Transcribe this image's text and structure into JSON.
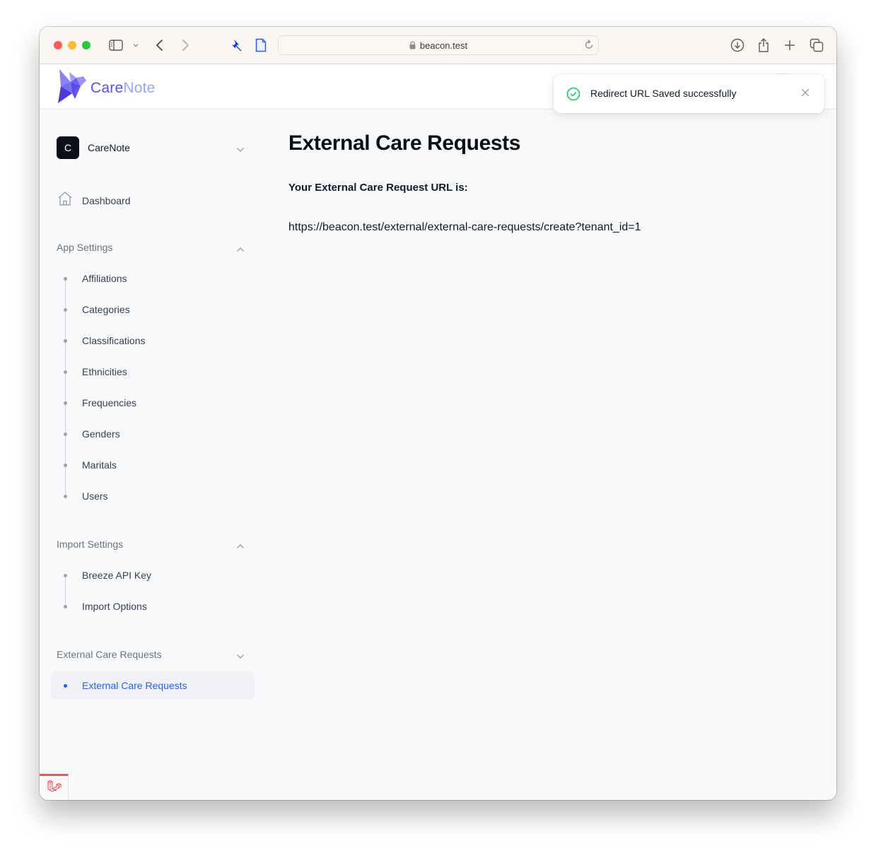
{
  "browser": {
    "url": "beacon.test",
    "icons": [
      "sidebar-icon",
      "chevron-down-icon",
      "back-icon",
      "forward-icon",
      "pin-icon",
      "page-icon",
      "lock-icon",
      "reload-icon",
      "download-icon",
      "share-icon",
      "new-tab-icon",
      "tab-overview-icon"
    ]
  },
  "header": {
    "brand_part1": "Care",
    "brand_part2": "Note"
  },
  "sidebar": {
    "tenant": {
      "initial": "C",
      "name": "CareNote"
    },
    "dashboard_label": "Dashboard",
    "groups": [
      {
        "title": "App Settings",
        "expanded": true,
        "items": [
          "Affiliations",
          "Categories",
          "Classifications",
          "Ethnicities",
          "Frequencies",
          "Genders",
          "Maritals",
          "Users"
        ]
      },
      {
        "title": "Import Settings",
        "expanded": true,
        "items": [
          "Breeze API Key",
          "Import Options"
        ]
      },
      {
        "title": "External Care Requests",
        "expanded": true,
        "items": [
          "External Care Requests"
        ],
        "active_item": "External Care Requests"
      }
    ]
  },
  "main": {
    "title": "External Care Requests",
    "url_label": "Your External Care Request URL is:",
    "url_value": "https://beacon.test/external/external-care-requests/create?tenant_id=1"
  },
  "toast": {
    "message": "Redirect URL Saved successfully",
    "status": "success"
  },
  "colors": {
    "accent": "#2563eb",
    "brand_primary": "#5b52e0",
    "brand_secondary": "#9aa6f2",
    "success": "#22c55e",
    "debug_bar": "#f4515f"
  }
}
